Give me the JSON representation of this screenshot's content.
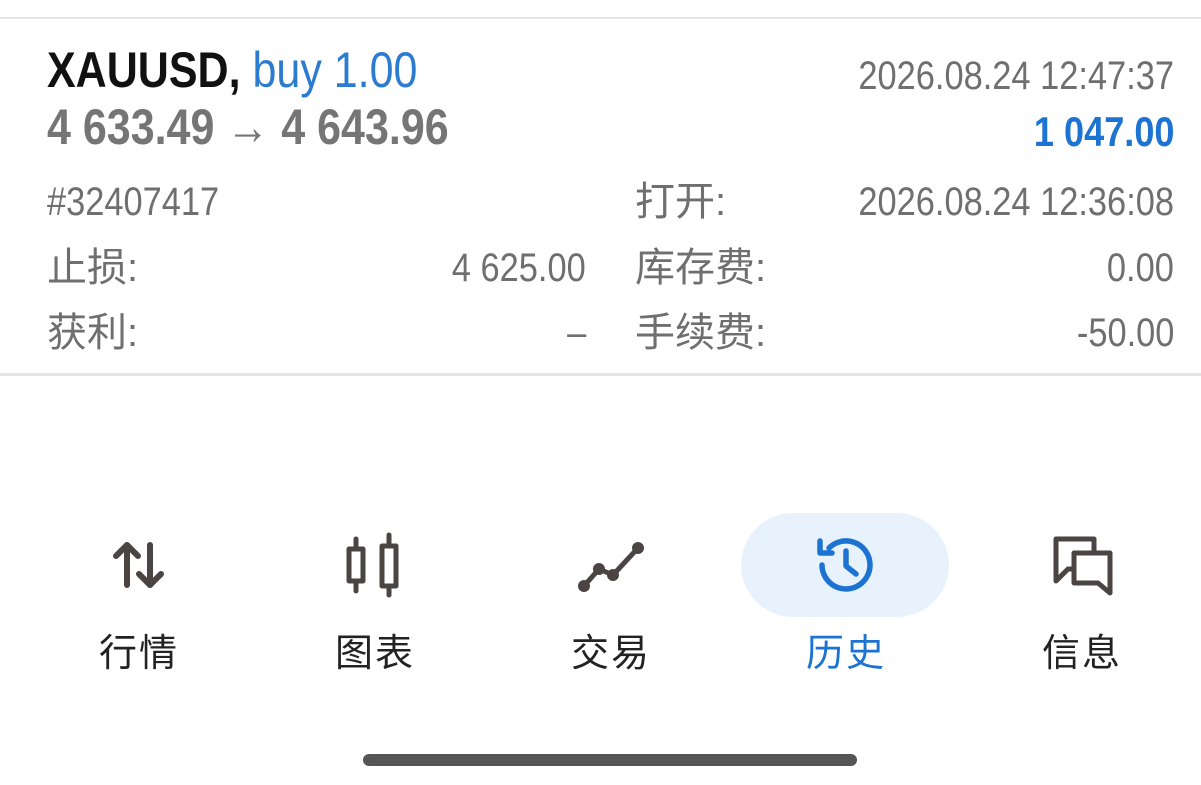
{
  "deal": {
    "symbol": "XAUUSD,",
    "trade_type": "buy 1.00",
    "prices": "4 633.49 → 4 643.96",
    "close_time": "2026.08.24 12:47:37",
    "profit": "1 047.00",
    "ticket": "#32407417",
    "open_label": "打开:",
    "open_time": "2026.08.24 12:36:08",
    "stoploss_label": "止损:",
    "stoploss_value": "4 625.00",
    "swap_label": "库存费:",
    "swap_value": "0.00",
    "takeprofit_label": "获利:",
    "takeprofit_value": "–",
    "commission_label": "手续费:",
    "commission_value": "-50.00"
  },
  "tabs": [
    {
      "label": "行情",
      "icon": "quotes-arrows-icon",
      "active": false
    },
    {
      "label": "图表",
      "icon": "candlestick-chart-icon",
      "active": false
    },
    {
      "label": "交易",
      "icon": "trade-line-icon",
      "active": false
    },
    {
      "label": "历史",
      "icon": "history-clock-icon",
      "active": true
    },
    {
      "label": "信息",
      "icon": "messages-icon",
      "active": false
    }
  ],
  "colors": {
    "accent_blue": "#1d73d1",
    "active_pill": "#e8f2fd",
    "icon_dark": "#4a4443",
    "text_gray": "#6f6f6f"
  }
}
